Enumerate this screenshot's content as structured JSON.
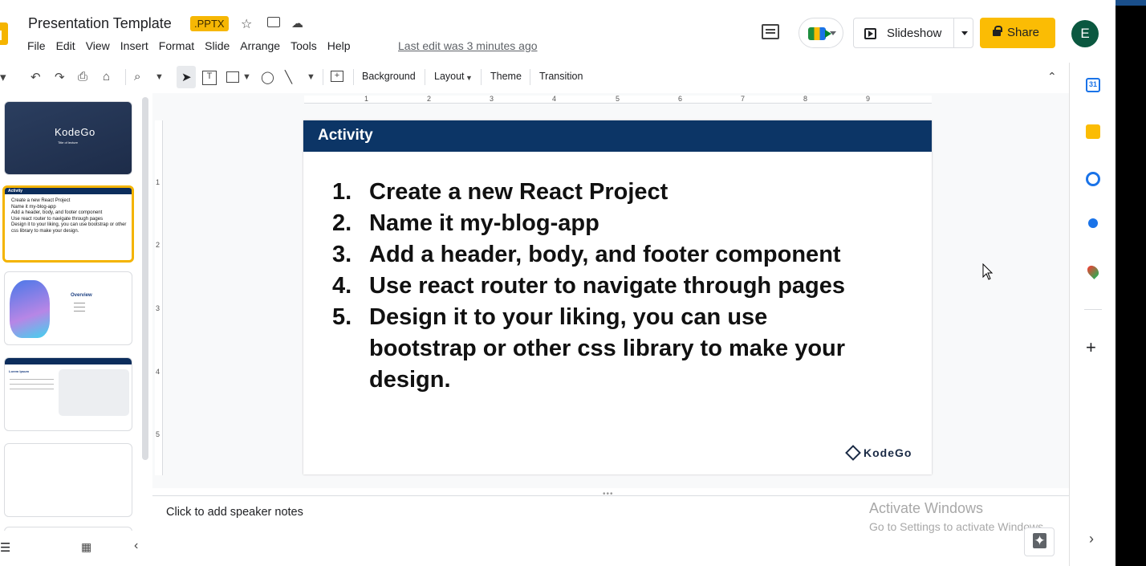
{
  "header": {
    "title": "Presentation Template",
    "badge": ".PPTX",
    "last_edit": "Last edit was 3 minutes ago",
    "slideshow_label": "Slideshow",
    "share_label": "Share",
    "avatar_initial": "E"
  },
  "menu": [
    "File",
    "Edit",
    "View",
    "Insert",
    "Format",
    "Slide",
    "Arrange",
    "Tools",
    "Help"
  ],
  "toolbar": {
    "background": "Background",
    "layout": "Layout",
    "theme": "Theme",
    "transition": "Transition"
  },
  "ruler": {
    "h_marks": [
      "1",
      "2",
      "3",
      "4",
      "5",
      "6",
      "7",
      "8",
      "9"
    ],
    "v_marks": [
      "1",
      "2",
      "3",
      "4",
      "5"
    ]
  },
  "filmstrip": {
    "slide1": {
      "brand": "KodeGo",
      "subtitle": "Title of lecture"
    },
    "slide2": {
      "title": "Activity",
      "items": [
        "Create a new React Project",
        "Name it my-blog-app",
        "Add a header, body, and footer component",
        "Use react router to navigate through pages",
        "Design it to your liking, you can use bootstrap or other css library to make your design."
      ]
    },
    "slide3": {
      "title": "Overview"
    },
    "slide4": {
      "title": "Lorem Ipsum"
    }
  },
  "slide": {
    "title": "Activity",
    "items": [
      {
        "num": "1.",
        "text": "Create a new React Project"
      },
      {
        "num": "2.",
        "text": "Name it my-blog-app"
      },
      {
        "num": "3.",
        "text": "Add a header, body, and footer component"
      },
      {
        "num": "4.",
        "text": "Use react router to navigate through pages"
      },
      {
        "num": "5.",
        "text": "Design it to your liking, you can use bootstrap or other css library to make your design."
      }
    ],
    "logo": "KodeGo"
  },
  "notes": {
    "placeholder": "Click to add speaker notes"
  },
  "watermark": {
    "line1": "Activate Windows",
    "line2": "Go to Settings to activate Windows."
  },
  "colors": {
    "slide_header": "#0c3566",
    "share": "#fbbc04",
    "badge": "#f6b704",
    "avatar": "#0b5840",
    "selected_thumb": "#f4b400"
  }
}
